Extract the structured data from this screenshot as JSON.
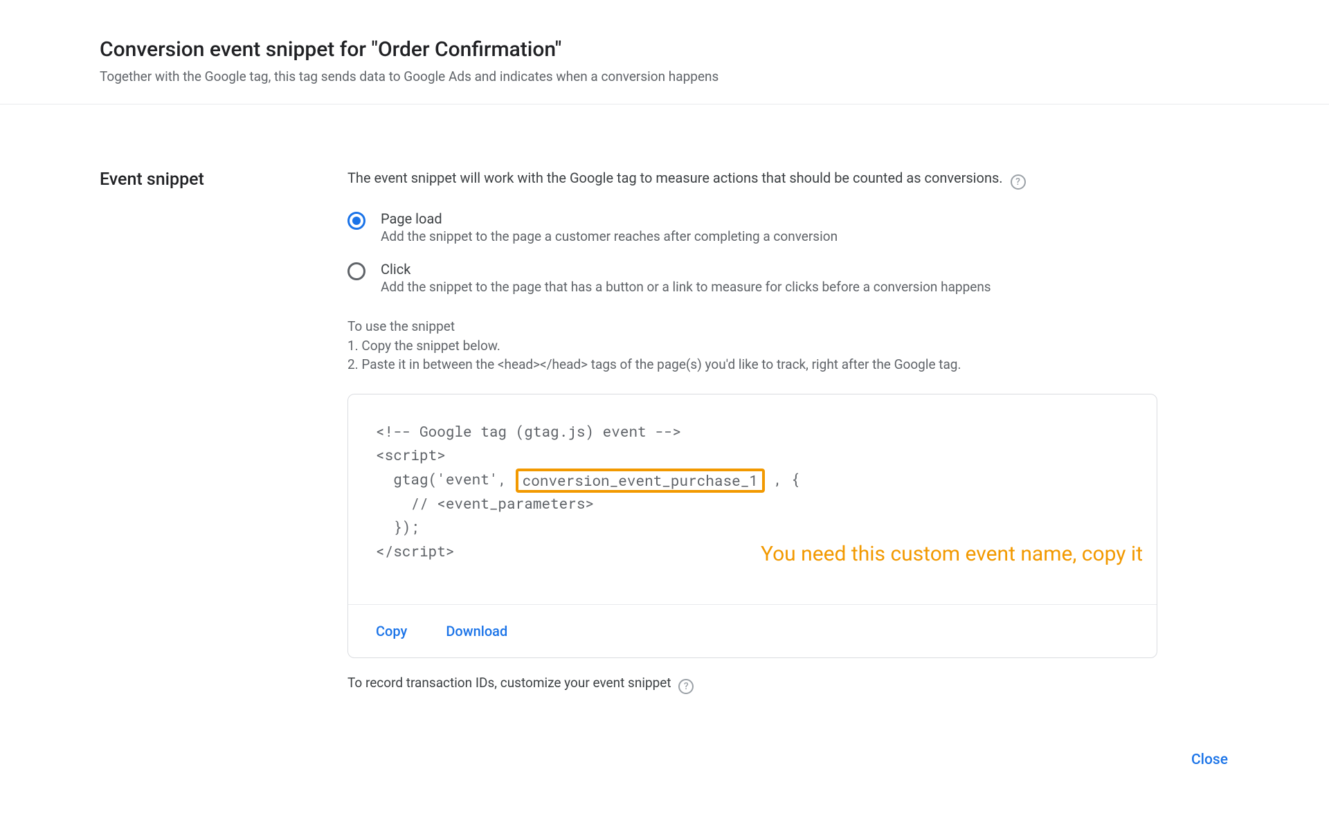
{
  "header": {
    "title": "Conversion event snippet for \"Order Confirmation\"",
    "subtitle": "Together with the Google tag, this tag sends data to Google Ads and indicates when a conversion happens"
  },
  "section": {
    "label": "Event snippet",
    "description": "The event snippet will work with the Google tag to measure actions that should be counted as conversions."
  },
  "radio": {
    "page_load": {
      "label": "Page load",
      "sub": "Add the snippet to the page a customer reaches after completing a conversion",
      "selected": true
    },
    "click": {
      "label": "Click",
      "sub": "Add the snippet to the page that has a button or a link to measure for clicks before a conversion happens",
      "selected": false
    }
  },
  "instructions": {
    "title": "To use the snippet",
    "step1": "1. Copy the snippet below.",
    "step2": "2. Paste it in between the <head></head> tags of the page(s) you'd like to track, right after the Google tag."
  },
  "code": {
    "line1": "<!-- Google tag (gtag.js) event -->",
    "line2": "<script>",
    "line3_pre": "  gtag('event', ",
    "line3_highlight": "conversion_event_purchase_1",
    "line3_post": " , {",
    "line4": "    // <event_parameters>",
    "line5": "  });",
    "line6": "</script>"
  },
  "annotation": "You need this custom event name, copy it",
  "actions": {
    "copy": "Copy",
    "download": "Download"
  },
  "footnote": "To record transaction IDs, customize your event snippet",
  "close": "Close",
  "help_glyph": "?"
}
